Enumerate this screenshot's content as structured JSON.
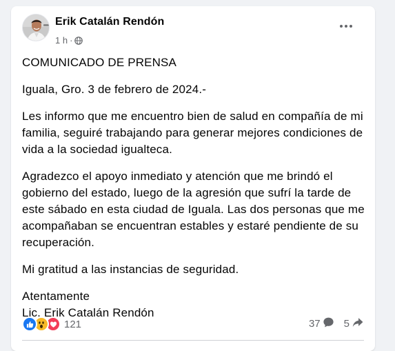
{
  "post": {
    "author": "Erik Catalán Rendón",
    "timestamp": "1 h",
    "separator": "·",
    "privacy_icon": "globe-icon",
    "menu_icon": "more-options-icon",
    "paragraphs": [
      "COMUNICADO DE PRENSA",
      "Iguala, Gro. 3 de febrero de 2024.-",
      "Les informo que me encuentro bien de salud en compañía de mi familia, seguiré trabajando para generar mejores condiciones de vida a la sociedad igualteca.",
      "Agradezco el apoyo inmediato y atención que me brindó el gobierno del estado, luego de la agresión que sufrí la tarde de este sábado en esta ciudad de Iguala. Las dos personas que me acompañaban se encuentran estables y estaré pendiente de su recuperación.",
      "Mi gratitud a las instancias de seguridad."
    ],
    "closing": "Atentamente",
    "signature": "Lic. Erik Catalán Rendón"
  },
  "footer": {
    "reaction_icons": [
      "like-icon",
      "wow-icon",
      "love-icon"
    ],
    "reaction_count": "121",
    "comment_count": "37",
    "share_count": "5"
  },
  "colors": {
    "background": "#f0f2f5",
    "card": "#ffffff",
    "text": "#050505",
    "secondary_text": "#65676b",
    "like": "#1877f2",
    "wow": "#f7b928",
    "love": "#f33e58",
    "divider": "#ced0d4"
  }
}
